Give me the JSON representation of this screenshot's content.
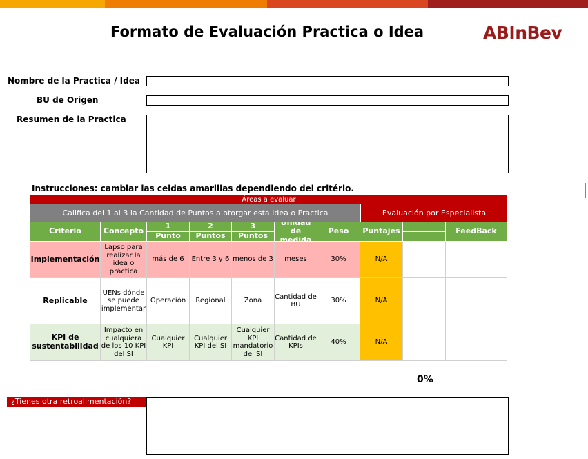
{
  "colors": {
    "red": "#c00000",
    "grey": "#808080",
    "green": "#70ad47",
    "pink": "#ffb3b3",
    "light_green": "#e2efda",
    "yellow": "#ffc000",
    "logo": "#9b1b1b"
  },
  "title": "Formato de Evaluación Practica o Idea",
  "logo_text": "ABInBev",
  "form": {
    "name_label": "Nombre de la Practica / Idea",
    "bu_label": "BU  de Origen",
    "summary_label": "Resumen de la Practica",
    "name_value": "",
    "bu_value": "",
    "summary_value": ""
  },
  "instructions": "Instrucciones: cambiar las celdas amarillas dependiendo del critério.",
  "table": {
    "areas_header": "Áreas a evaluar",
    "califica_header": "Califica del 1 al 3 la Cantidad de Puntos a otorgar esta Idea o Practica",
    "evaluacion_header": "Evaluación por Especialista",
    "columns": {
      "criterio": "Criterio",
      "concepto": "Concepto",
      "p1_num": "1",
      "p1_label": "Punto",
      "p2_num": "2",
      "p2_label": "Puntos",
      "p3_num": "3",
      "p3_label": "Puntos",
      "unidad": "Unidad de medida",
      "peso": "Peso",
      "puntajes": "Puntajes",
      "feedback": "FeedBack"
    },
    "rows": [
      {
        "criterio": "Implementación",
        "concepto": "Lapso para realizar la idea o práctica",
        "p1": "más de 6",
        "p2": "Entre 3 y 6",
        "p3": "menos de 3",
        "unidad": "meses",
        "peso": "30%",
        "puntaje": "N/A",
        "feedback": ""
      },
      {
        "criterio": "Replicable",
        "concepto": "UENs dónde se puede implementar",
        "p1": "Operación",
        "p2": "Regional",
        "p3": "Zona",
        "unidad": "Cantidad de BU",
        "peso": "30%",
        "puntaje": "N/A",
        "feedback": ""
      },
      {
        "criterio": "KPI de sustentabilidad",
        "concepto": "Impacto en cualquiera de los 10 KPI del SI",
        "p1": "Cualquier KPI",
        "p2": "Cualquier KPI del SI",
        "p3": "Cualquier KPI mandatorio del SI",
        "unidad": "Cantidad de KPIs",
        "peso": "40%",
        "puntaje": "N/A",
        "feedback": ""
      }
    ]
  },
  "total_score": "0%",
  "feedback_question": "¿Tienes otra retroalimentación?",
  "feedback_value": ""
}
